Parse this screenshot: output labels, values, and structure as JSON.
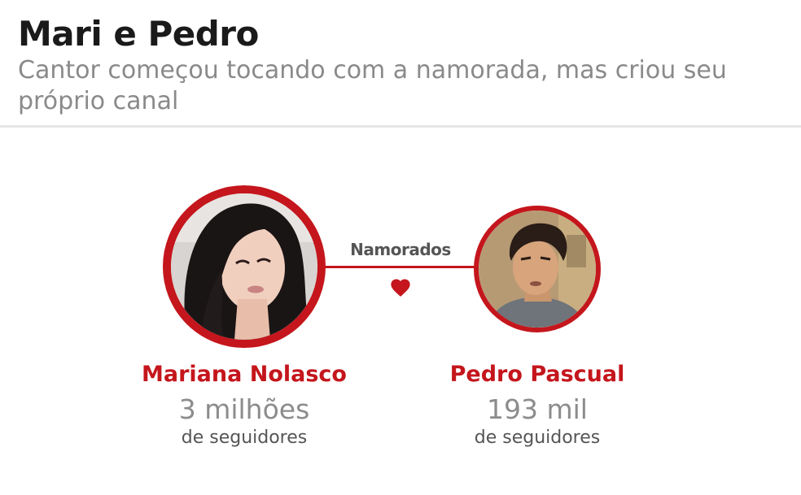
{
  "header": {
    "title": "Mari e Pedro",
    "subtitle": "Cantor começou tocando com a namorada, mas criou seu próprio canal"
  },
  "relationship": {
    "label": "Namorados",
    "icon": "heart-icon",
    "color": "#c4161c"
  },
  "people": [
    {
      "name": "Mariana Nolasco",
      "followers_count": "3 milhões",
      "followers_label": "de seguidores",
      "photo": "woman-portrait"
    },
    {
      "name": "Pedro Pascual",
      "followers_count": "193 mil",
      "followers_label": "de seguidores",
      "photo": "man-portrait"
    }
  ],
  "colors": {
    "accent": "#c4161c",
    "title": "#1a1a1a",
    "subtitle": "#8a8a8a"
  }
}
